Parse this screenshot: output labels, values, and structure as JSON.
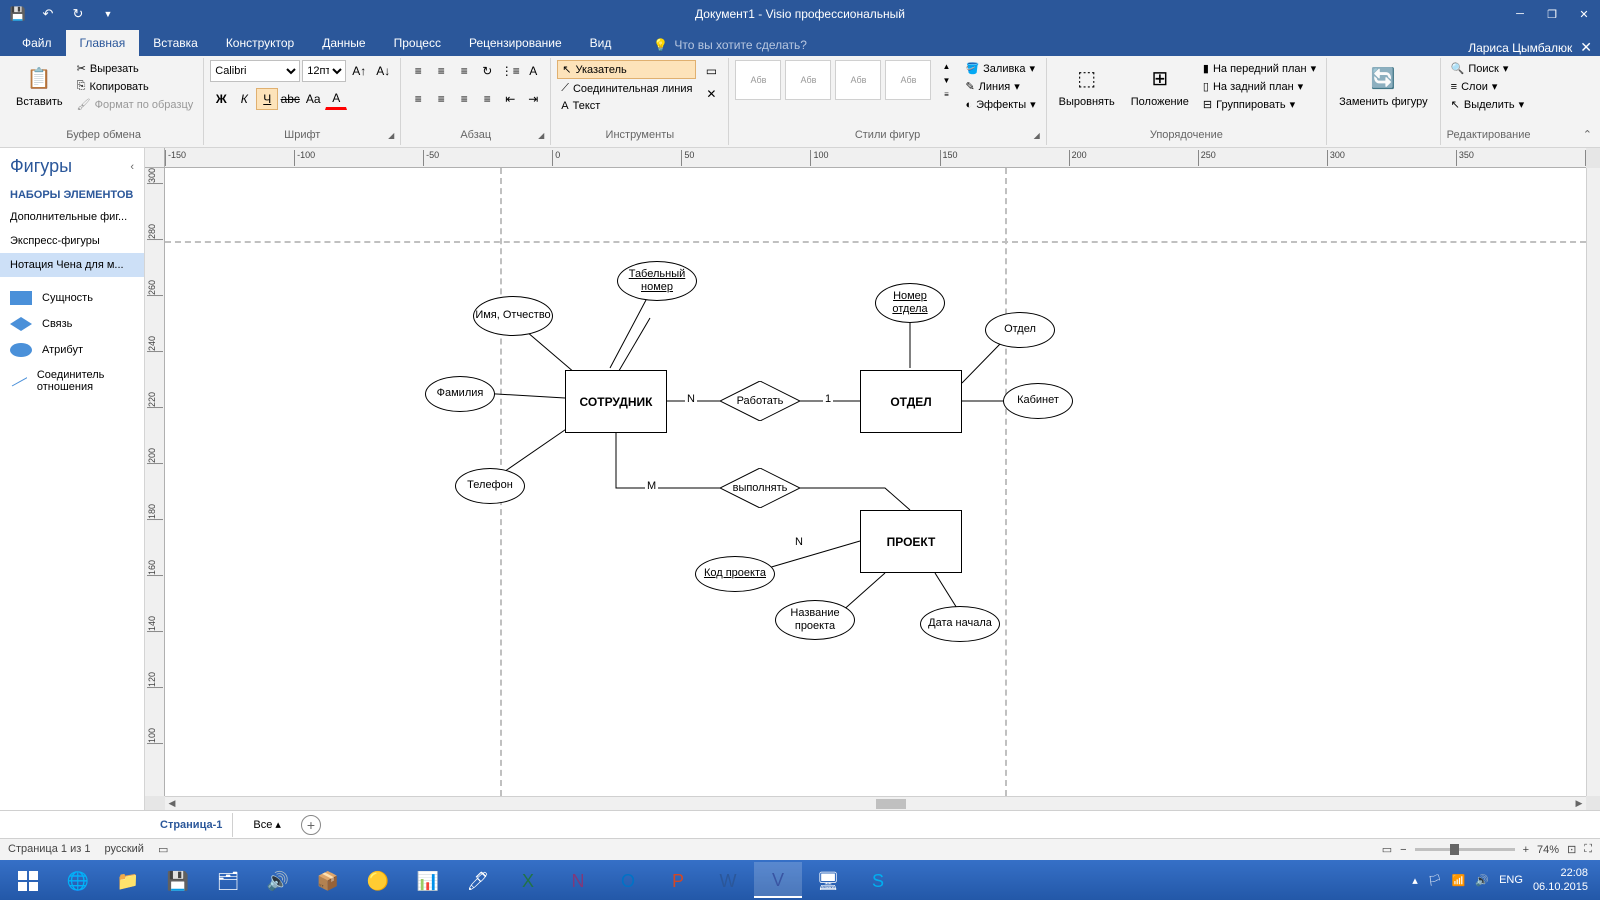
{
  "title": "Документ1 - Visio профессиональный",
  "user": "Лариса Цымбалюк",
  "tellMe": "Что вы хотите сделать?",
  "tabs": {
    "file": "Файл",
    "home": "Главная",
    "insert": "Вставка",
    "design": "Конструктор",
    "data": "Данные",
    "process": "Процесс",
    "review": "Рецензирование",
    "view": "Вид"
  },
  "ribbon": {
    "paste": "Вставить",
    "cut": "Вырезать",
    "copy": "Копировать",
    "formatPainter": "Формат по образцу",
    "clipboard": "Буфер обмена",
    "fontGroup": "Шрифт",
    "fontName": "Calibri",
    "fontSize": "12пт",
    "paragraph": "Абзац",
    "tools": "Инструменты",
    "pointer": "Указатель",
    "connector": "Соединительная линия",
    "text": "Текст",
    "shapeStyles": "Стили фигур",
    "fill": "Заливка",
    "line": "Линия",
    "effects": "Эффекты",
    "arrange": "Упорядочение",
    "align": "Выровнять",
    "position": "Положение",
    "bringFront": "На передний план",
    "sendBack": "На задний план",
    "group": "Группировать",
    "changeShape": "Заменить фигуру",
    "editing": "Редактирование",
    "find": "Поиск",
    "layers": "Слои",
    "select": "Выделить",
    "thumb": "Абв"
  },
  "shapes": {
    "title": "Фигуры",
    "stencilSets": "НАБОРЫ ЭЛЕМЕНТОВ",
    "more": "Дополнительные фиг...",
    "quick": "Экспресс-фигуры",
    "chen": "Нотация Чена для м...",
    "entity": "Сущность",
    "relation": "Связь",
    "attribute": "Атрибут",
    "connLine": "Соединитель отношения"
  },
  "diagram": {
    "entities": {
      "employee": "СОТРУДНИК",
      "department": "ОТДЕЛ",
      "project": "ПРОЕКТ"
    },
    "rels": {
      "work": "Работать",
      "perform": "выполнять"
    },
    "attrs": {
      "tabNum": "Табельный номер",
      "name": "Имя, Отчество",
      "surname": "Фамилия",
      "phone": "Телефон",
      "deptNum": "Номер отдела",
      "dept": "Отдел",
      "office": "Кабинет",
      "projCode": "Код проекта",
      "projName": "Название проекта",
      "startDate": "Дата начала"
    },
    "card": {
      "n": "N",
      "one": "1",
      "m": "M"
    }
  },
  "pageTabs": {
    "page1": "Страница-1",
    "all": "Все"
  },
  "status": {
    "page": "Страница 1 из 1",
    "lang": "русский",
    "zoom": "74%"
  },
  "taskbar": {
    "lang": "ENG",
    "time": "22:08",
    "date": "06.10.2015"
  }
}
